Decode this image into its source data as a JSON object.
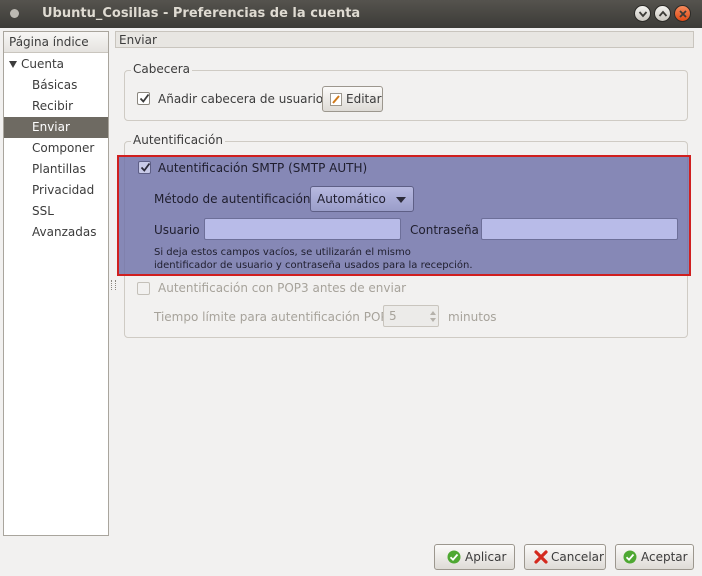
{
  "window": {
    "title": "Ubuntu_Cosillas - Preferencias de la cuenta"
  },
  "sidebar": {
    "header": "Página índice",
    "group": "Cuenta",
    "items": [
      {
        "label": "Básicas",
        "selected": false
      },
      {
        "label": "Recibir",
        "selected": false
      },
      {
        "label": "Enviar",
        "selected": true
      },
      {
        "label": "Componer",
        "selected": false
      },
      {
        "label": "Plantillas",
        "selected": false
      },
      {
        "label": "Privacidad",
        "selected": false
      },
      {
        "label": "SSL",
        "selected": false
      },
      {
        "label": "Avanzadas",
        "selected": false
      }
    ]
  },
  "page": {
    "header": "Enviar"
  },
  "cabecera": {
    "title": "Cabecera",
    "add_header_label": "Añadir cabecera de usuario",
    "add_header_checked": true,
    "edit_button": "Editar"
  },
  "auth": {
    "title": "Autentificación",
    "smtp_auth_label": "Autentificación SMTP (SMTP AUTH)",
    "smtp_auth_checked": true,
    "method_label": "Método de autentificación",
    "method_value": "Automático",
    "user_label": "Usuario",
    "user_value": "",
    "password_label": "Contraseña",
    "password_value": "",
    "note_line1": "Si deja estos campos vacíos, se utilizarán el mismo",
    "note_line2": "identificador de usuario y contraseña usados para la recepción.",
    "pop3_label": "Autentificación con POP3 antes de enviar",
    "pop3_checked": false,
    "pop_timeout_label": "Tiempo límite para autentificación POP:",
    "pop_timeout_value": "5",
    "pop_timeout_unit": "minutos"
  },
  "buttons": {
    "apply": "Aplicar",
    "cancel": "Cancelar",
    "accept": "Aceptar"
  },
  "colors": {
    "highlight_border": "#d01f1f",
    "selection": "#6e6a62",
    "titlebar": "#3c3b37"
  }
}
